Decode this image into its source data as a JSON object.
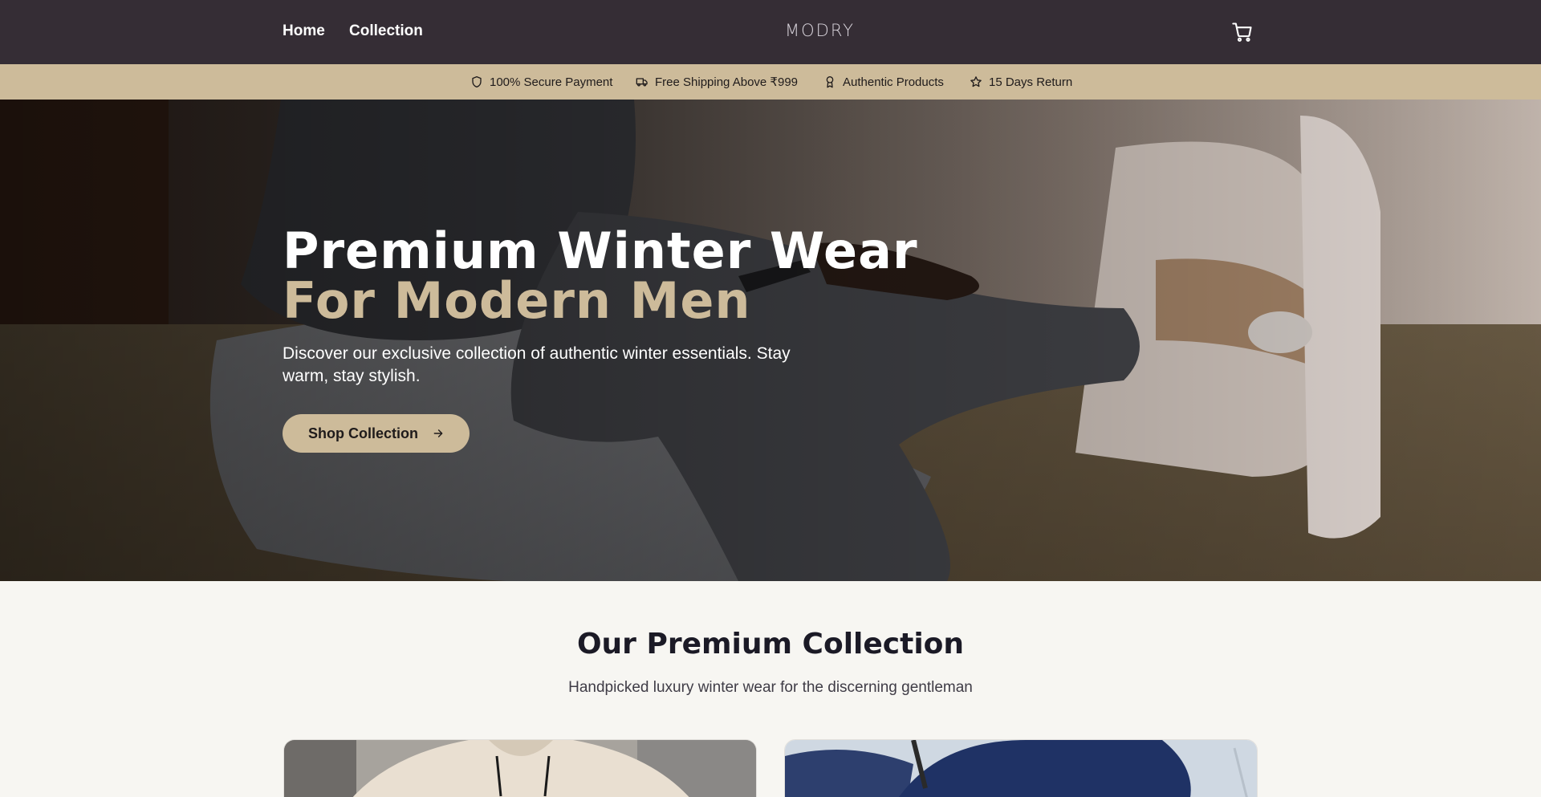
{
  "nav": {
    "home_label": "Home",
    "collection_label": "Collection",
    "logo_text": "MODRY",
    "cart_icon": "cart-icon"
  },
  "trust_bar": {
    "items": [
      {
        "icon": "shield-icon",
        "label": "100% Secure Payment"
      },
      {
        "icon": "truck-icon",
        "label": "Free Shipping Above ₹999"
      },
      {
        "icon": "award-icon",
        "label": "Authentic Products"
      },
      {
        "icon": "star-icon",
        "label": "15 Days Return"
      }
    ]
  },
  "hero": {
    "title_line1": "Premium Winter Wear",
    "title_line2": "For Modern Men",
    "subtitle": "Discover our exclusive collection of authentic winter essentials. Stay warm, stay stylish.",
    "cta_label": "Shop Collection"
  },
  "collection": {
    "title": "Our Premium Collection",
    "subtitle": "Handpicked luxury winter wear for the discerning gentleman"
  },
  "colors": {
    "nav_bg": "#352d35",
    "accent": "#cdbb9a",
    "page_bg": "#f7f6f2"
  }
}
